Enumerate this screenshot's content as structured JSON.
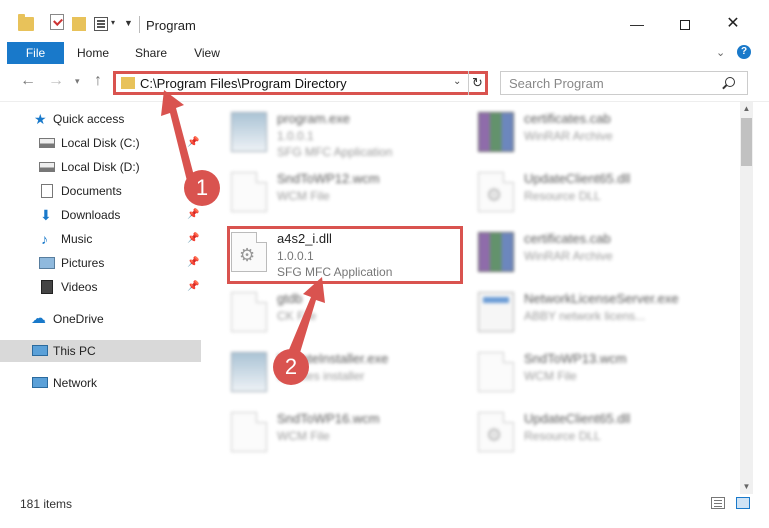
{
  "window": {
    "title": "Program",
    "min_glyph": "—",
    "close_glyph": "✕"
  },
  "ribbon": {
    "tabs": [
      "File",
      "Home",
      "Share",
      "View"
    ]
  },
  "address": {
    "path": "C:\\Program Files\\Program Directory",
    "search_placeholder": "Search Program"
  },
  "sidebar": {
    "items": [
      {
        "label": "Quick access",
        "icon": "star-icon",
        "pinned": false
      },
      {
        "label": "Local Disk (C:)",
        "icon": "drive-icon",
        "pinned": true
      },
      {
        "label": "Local Disk (D:)",
        "icon": "drive-icon",
        "pinned": false
      },
      {
        "label": "Documents",
        "icon": "documents-icon",
        "pinned": true
      },
      {
        "label": "Downloads",
        "icon": "download-icon",
        "pinned": true
      },
      {
        "label": "Music",
        "icon": "music-icon",
        "pinned": true
      },
      {
        "label": "Pictures",
        "icon": "pictures-icon",
        "pinned": true
      },
      {
        "label": "Videos",
        "icon": "videos-icon",
        "pinned": true
      },
      {
        "label": "OneDrive",
        "icon": "onedrive-icon",
        "pinned": false
      },
      {
        "label": "This PC",
        "icon": "computer-icon",
        "pinned": false,
        "selected": true
      },
      {
        "label": "Network",
        "icon": "network-icon",
        "pinned": false
      }
    ]
  },
  "files": [
    {
      "name": "program.exe",
      "sub1": "1.0.0.1",
      "sub2": "SFG MFC Application",
      "icon": "exe-icon",
      "blurred": true
    },
    {
      "name": "certificates.cab",
      "sub1": "WinRAR Archive",
      "sub2": "",
      "icon": "rar-icon",
      "blurred": true
    },
    {
      "name": "SndToWP12.wcm",
      "sub1": "WCM File",
      "sub2": "",
      "icon": "file-icon",
      "blurred": true
    },
    {
      "name": "UpdateClient65.dll",
      "sub1": "Resource DLL",
      "sub2": "",
      "icon": "dll-icon",
      "blurred": true
    },
    {
      "name": "a4s2_i.dll",
      "sub1": "1.0.0.1",
      "sub2": "SFG MFC Application",
      "icon": "dll-icon",
      "blurred": false
    },
    {
      "name": "certificates.cab",
      "sub1": "WinRAR Archive",
      "sub2": "",
      "icon": "rar-icon",
      "blurred": true
    },
    {
      "name": "gtdb",
      "sub1": "CK File",
      "sub2": "",
      "icon": "file-icon",
      "blurred": true
    },
    {
      "name": "NetworkLicenseServer.exe",
      "sub1": "ABBY network licens...",
      "sub2": "",
      "icon": "app-icon",
      "blurred": true
    },
    {
      "name": "UpdateInstaller.exe",
      "sub1": "updates installer",
      "sub2": "",
      "icon": "exe-icon",
      "blurred": true
    },
    {
      "name": "SndToWP13.wcm",
      "sub1": "WCM File",
      "sub2": "",
      "icon": "file-icon",
      "blurred": true
    },
    {
      "name": "SndToWP16.wcm",
      "sub1": "WCM File",
      "sub2": "",
      "icon": "file-icon",
      "blurred": true
    },
    {
      "name": "UpdateClient65.dll",
      "sub1": "Resource DLL",
      "sub2": "",
      "icon": "dll-icon",
      "blurred": true
    }
  ],
  "status": {
    "item_count": "181 items"
  },
  "annotations": {
    "step1": "1",
    "step2": "2",
    "color": "#d9534f"
  },
  "colors": {
    "accent": "#1979ca",
    "selection": "#d9d9d9",
    "annotation": "#d9534f"
  }
}
